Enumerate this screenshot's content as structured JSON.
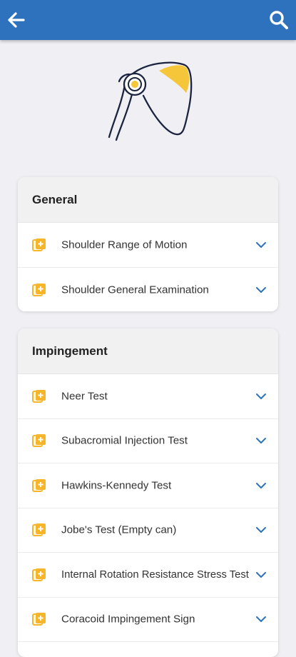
{
  "header": {
    "back_icon": "arrow-left-icon",
    "search_icon": "search-icon",
    "bar_color": "#2e72bd"
  },
  "hero": {
    "icon": "shoulder-illustration",
    "accent_color": "#f5c53a"
  },
  "sections": [
    {
      "title": "General",
      "items": [
        {
          "label": "Shoulder Range of Motion"
        },
        {
          "label": "Shoulder General Examination"
        }
      ]
    },
    {
      "title": "Impingement",
      "items": [
        {
          "label": "Neer Test"
        },
        {
          "label": "Subacromial Injection Test"
        },
        {
          "label": "Hawkins-Kennedy Test"
        },
        {
          "label": "Jobe's Test (Empty can)"
        },
        {
          "label": "Internal Rotation Resistance Stress Test"
        },
        {
          "label": "Coracoid Impingement Sign"
        }
      ]
    }
  ],
  "colors": {
    "item_icon": "#f7b62a",
    "chevron": "#2e72bd"
  }
}
